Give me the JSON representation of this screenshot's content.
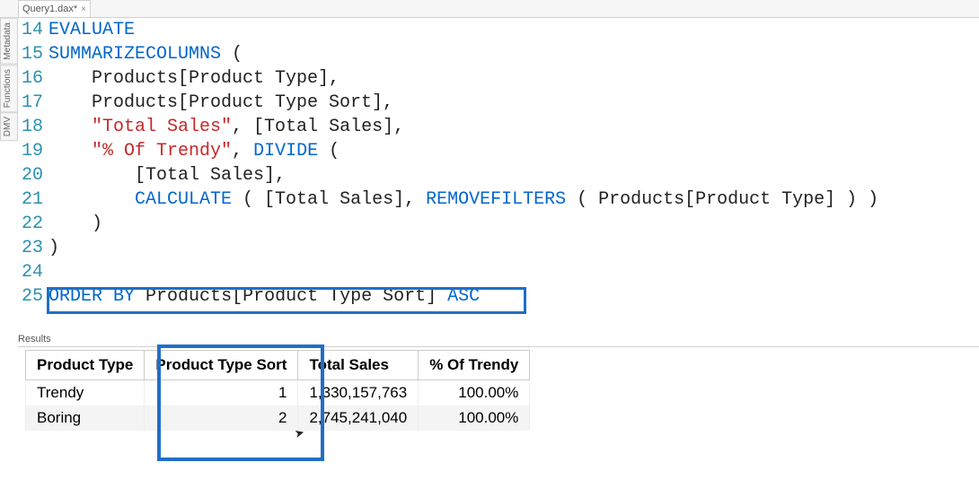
{
  "tab": {
    "title": "Query1.dax*"
  },
  "side": {
    "metadata": "Metadata",
    "functions": "Functions",
    "dmv": "DMV"
  },
  "code": {
    "l14": "EVALUATE",
    "l15a": "SUMMARIZECOLUMNS",
    "l15b": " (",
    "l16": "    Products[Product Type],",
    "l17": "    Products[Product Type Sort],",
    "l18a": "    ",
    "l18b": "\"Total Sales\"",
    "l18c": ", [Total Sales],",
    "l19a": "    ",
    "l19b": "\"% Of Trendy\"",
    "l19c": ", ",
    "l19d": "DIVIDE",
    "l19e": " (",
    "l20": "        [Total Sales],",
    "l21a": "        ",
    "l21b": "CALCULATE",
    "l21c": " ( [Total Sales], ",
    "l21d": "REMOVEFILTERS",
    "l21e": " ( Products[Product Type] ) )",
    "l22": "    )",
    "l23": ")",
    "l24": "",
    "l25a": "ORDER",
    "l25b": " ",
    "l25c": "BY",
    "l25d": " Products[Product Type Sort] ",
    "l25e": "ASC"
  },
  "lines": {
    "n14": "14",
    "n15": "15",
    "n16": "16",
    "n17": "17",
    "n18": "18",
    "n19": "19",
    "n20": "20",
    "n21": "21",
    "n22": "22",
    "n23": "23",
    "n24": "24",
    "n25": "25"
  },
  "results": {
    "label": "Results",
    "headers": {
      "c0": "Product Type",
      "c1": "Product Type Sort",
      "c2": "Total Sales",
      "c3": "% Of Trendy"
    },
    "rows": [
      {
        "c0": "Trendy",
        "c1": "1",
        "c2": "1,330,157,763",
        "c3": "100.00%"
      },
      {
        "c0": "Boring",
        "c1": "2",
        "c2": "2,745,241,040",
        "c3": "100.00%"
      }
    ]
  }
}
